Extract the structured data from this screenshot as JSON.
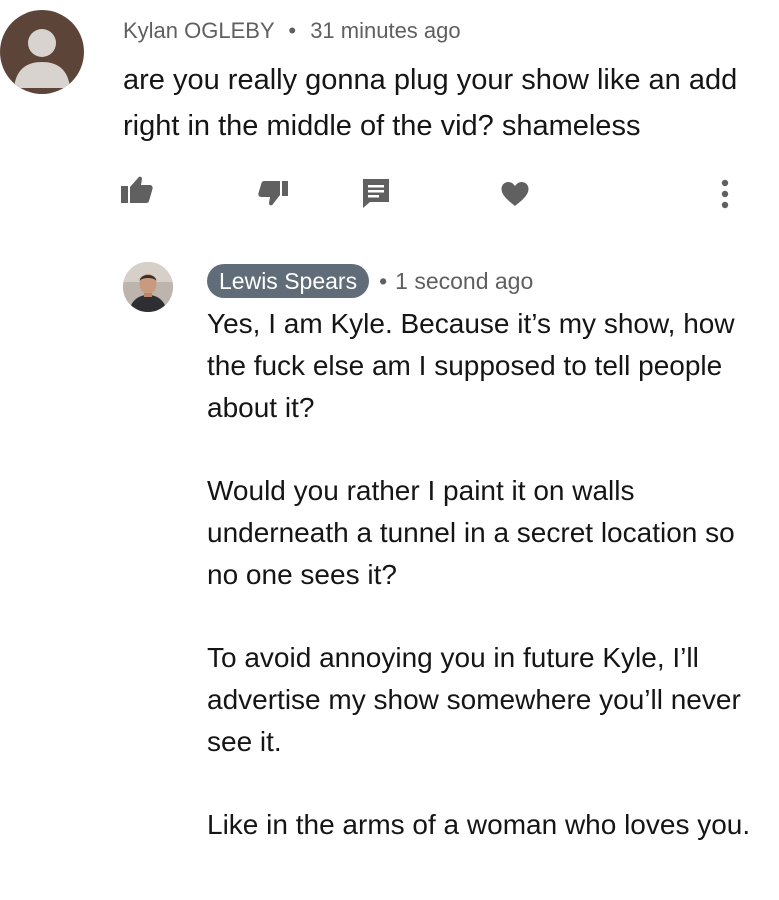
{
  "comment": {
    "author": "Kylan OGLEBY",
    "separator": "•",
    "time": "31 minutes ago",
    "text": "are you really gonna plug your show like an add right in the middle of the vid? shameless"
  },
  "actions": {
    "icons": [
      "thumbs-up-icon",
      "thumbs-down-icon",
      "reply-icon",
      "heart-icon",
      "more-vert-icon"
    ]
  },
  "reply": {
    "author": "Lewis Spears",
    "separator": "•",
    "time": "1 second ago",
    "paragraphs": [
      "Yes, I am Kyle. Because it’s my show, how the fuck else am I supposed to tell people about it?",
      "Would you rather I paint it on walls underneath a tunnel in a secret location so no one sees it?",
      "To avoid annoying you in future Kyle,  I’ll advertise my show somewhere you’ll never see it.",
      "Like in the arms of a woman who loves you."
    ]
  },
  "colors": {
    "icon": "#606060",
    "meta_text": "#5f5f5f",
    "badge_bg": "#606d79",
    "default_avatar_bg": "#5c4538",
    "default_avatar_fg": "#d9d3d0"
  }
}
